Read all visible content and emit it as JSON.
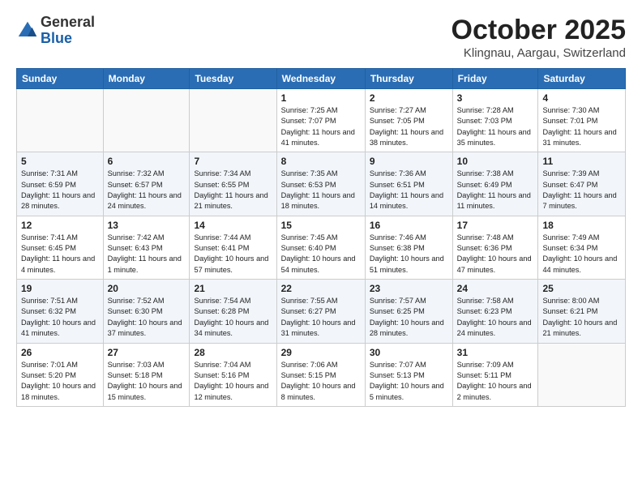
{
  "logo": {
    "general": "General",
    "blue": "Blue"
  },
  "title": "October 2025",
  "location": "Klingnau, Aargau, Switzerland",
  "days_of_week": [
    "Sunday",
    "Monday",
    "Tuesday",
    "Wednesday",
    "Thursday",
    "Friday",
    "Saturday"
  ],
  "weeks": [
    [
      {
        "day": "",
        "info": ""
      },
      {
        "day": "",
        "info": ""
      },
      {
        "day": "",
        "info": ""
      },
      {
        "day": "1",
        "info": "Sunrise: 7:25 AM\nSunset: 7:07 PM\nDaylight: 11 hours and 41 minutes."
      },
      {
        "day": "2",
        "info": "Sunrise: 7:27 AM\nSunset: 7:05 PM\nDaylight: 11 hours and 38 minutes."
      },
      {
        "day": "3",
        "info": "Sunrise: 7:28 AM\nSunset: 7:03 PM\nDaylight: 11 hours and 35 minutes."
      },
      {
        "day": "4",
        "info": "Sunrise: 7:30 AM\nSunset: 7:01 PM\nDaylight: 11 hours and 31 minutes."
      }
    ],
    [
      {
        "day": "5",
        "info": "Sunrise: 7:31 AM\nSunset: 6:59 PM\nDaylight: 11 hours and 28 minutes."
      },
      {
        "day": "6",
        "info": "Sunrise: 7:32 AM\nSunset: 6:57 PM\nDaylight: 11 hours and 24 minutes."
      },
      {
        "day": "7",
        "info": "Sunrise: 7:34 AM\nSunset: 6:55 PM\nDaylight: 11 hours and 21 minutes."
      },
      {
        "day": "8",
        "info": "Sunrise: 7:35 AM\nSunset: 6:53 PM\nDaylight: 11 hours and 18 minutes."
      },
      {
        "day": "9",
        "info": "Sunrise: 7:36 AM\nSunset: 6:51 PM\nDaylight: 11 hours and 14 minutes."
      },
      {
        "day": "10",
        "info": "Sunrise: 7:38 AM\nSunset: 6:49 PM\nDaylight: 11 hours and 11 minutes."
      },
      {
        "day": "11",
        "info": "Sunrise: 7:39 AM\nSunset: 6:47 PM\nDaylight: 11 hours and 7 minutes."
      }
    ],
    [
      {
        "day": "12",
        "info": "Sunrise: 7:41 AM\nSunset: 6:45 PM\nDaylight: 11 hours and 4 minutes."
      },
      {
        "day": "13",
        "info": "Sunrise: 7:42 AM\nSunset: 6:43 PM\nDaylight: 11 hours and 1 minute."
      },
      {
        "day": "14",
        "info": "Sunrise: 7:44 AM\nSunset: 6:41 PM\nDaylight: 10 hours and 57 minutes."
      },
      {
        "day": "15",
        "info": "Sunrise: 7:45 AM\nSunset: 6:40 PM\nDaylight: 10 hours and 54 minutes."
      },
      {
        "day": "16",
        "info": "Sunrise: 7:46 AM\nSunset: 6:38 PM\nDaylight: 10 hours and 51 minutes."
      },
      {
        "day": "17",
        "info": "Sunrise: 7:48 AM\nSunset: 6:36 PM\nDaylight: 10 hours and 47 minutes."
      },
      {
        "day": "18",
        "info": "Sunrise: 7:49 AM\nSunset: 6:34 PM\nDaylight: 10 hours and 44 minutes."
      }
    ],
    [
      {
        "day": "19",
        "info": "Sunrise: 7:51 AM\nSunset: 6:32 PM\nDaylight: 10 hours and 41 minutes."
      },
      {
        "day": "20",
        "info": "Sunrise: 7:52 AM\nSunset: 6:30 PM\nDaylight: 10 hours and 37 minutes."
      },
      {
        "day": "21",
        "info": "Sunrise: 7:54 AM\nSunset: 6:28 PM\nDaylight: 10 hours and 34 minutes."
      },
      {
        "day": "22",
        "info": "Sunrise: 7:55 AM\nSunset: 6:27 PM\nDaylight: 10 hours and 31 minutes."
      },
      {
        "day": "23",
        "info": "Sunrise: 7:57 AM\nSunset: 6:25 PM\nDaylight: 10 hours and 28 minutes."
      },
      {
        "day": "24",
        "info": "Sunrise: 7:58 AM\nSunset: 6:23 PM\nDaylight: 10 hours and 24 minutes."
      },
      {
        "day": "25",
        "info": "Sunrise: 8:00 AM\nSunset: 6:21 PM\nDaylight: 10 hours and 21 minutes."
      }
    ],
    [
      {
        "day": "26",
        "info": "Sunrise: 7:01 AM\nSunset: 5:20 PM\nDaylight: 10 hours and 18 minutes."
      },
      {
        "day": "27",
        "info": "Sunrise: 7:03 AM\nSunset: 5:18 PM\nDaylight: 10 hours and 15 minutes."
      },
      {
        "day": "28",
        "info": "Sunrise: 7:04 AM\nSunset: 5:16 PM\nDaylight: 10 hours and 12 minutes."
      },
      {
        "day": "29",
        "info": "Sunrise: 7:06 AM\nSunset: 5:15 PM\nDaylight: 10 hours and 8 minutes."
      },
      {
        "day": "30",
        "info": "Sunrise: 7:07 AM\nSunset: 5:13 PM\nDaylight: 10 hours and 5 minutes."
      },
      {
        "day": "31",
        "info": "Sunrise: 7:09 AM\nSunset: 5:11 PM\nDaylight: 10 hours and 2 minutes."
      },
      {
        "day": "",
        "info": ""
      }
    ]
  ]
}
